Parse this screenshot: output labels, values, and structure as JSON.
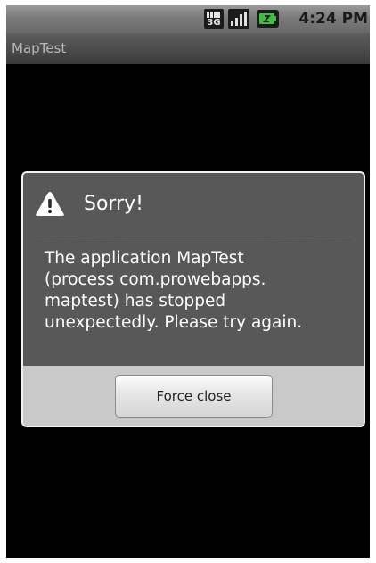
{
  "status_bar": {
    "network_type": "3G",
    "time": "4:24 PM",
    "icons": [
      "3g-icon",
      "signal-icon",
      "battery-icon"
    ]
  },
  "app": {
    "title": "MapTest"
  },
  "dialog": {
    "icon": "warning-icon",
    "title": "Sorry!",
    "message": "The application MapTest\n(process com.prowebapps.\nmaptest) has stopped\nunexpectedly. Please try again.",
    "button_label": "Force close"
  },
  "colors": {
    "dialog_body": "#585858",
    "dialog_footer": "#c9c9c9",
    "background": "#000000"
  }
}
